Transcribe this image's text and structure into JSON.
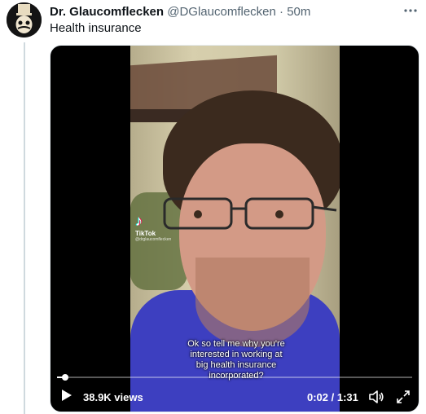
{
  "author": {
    "name": "Dr. Glaucomflecken",
    "handle": "@DGlaucomflecken",
    "separator": "·",
    "time": "50m"
  },
  "tweet": {
    "text": "Health insurance"
  },
  "video": {
    "watermark_brand": "TikTok",
    "watermark_handle": "@drglaucomflecken",
    "caption_lines": [
      "Ok so tell me why you're",
      "interested in working at",
      "big health insurance",
      "incorporated?"
    ],
    "views": "38.9K views",
    "timecode": "0:02 / 1:31",
    "progress": 0.022
  },
  "icons": {
    "more": "more-icon",
    "play": "play-icon",
    "volume": "volume-icon",
    "fullscreen": "fullscreen-icon",
    "tiktok": "tiktok-logo-icon"
  },
  "colors": {
    "text_primary": "#0f1419",
    "text_secondary": "#536471",
    "shirt": "#3d3fc0"
  }
}
